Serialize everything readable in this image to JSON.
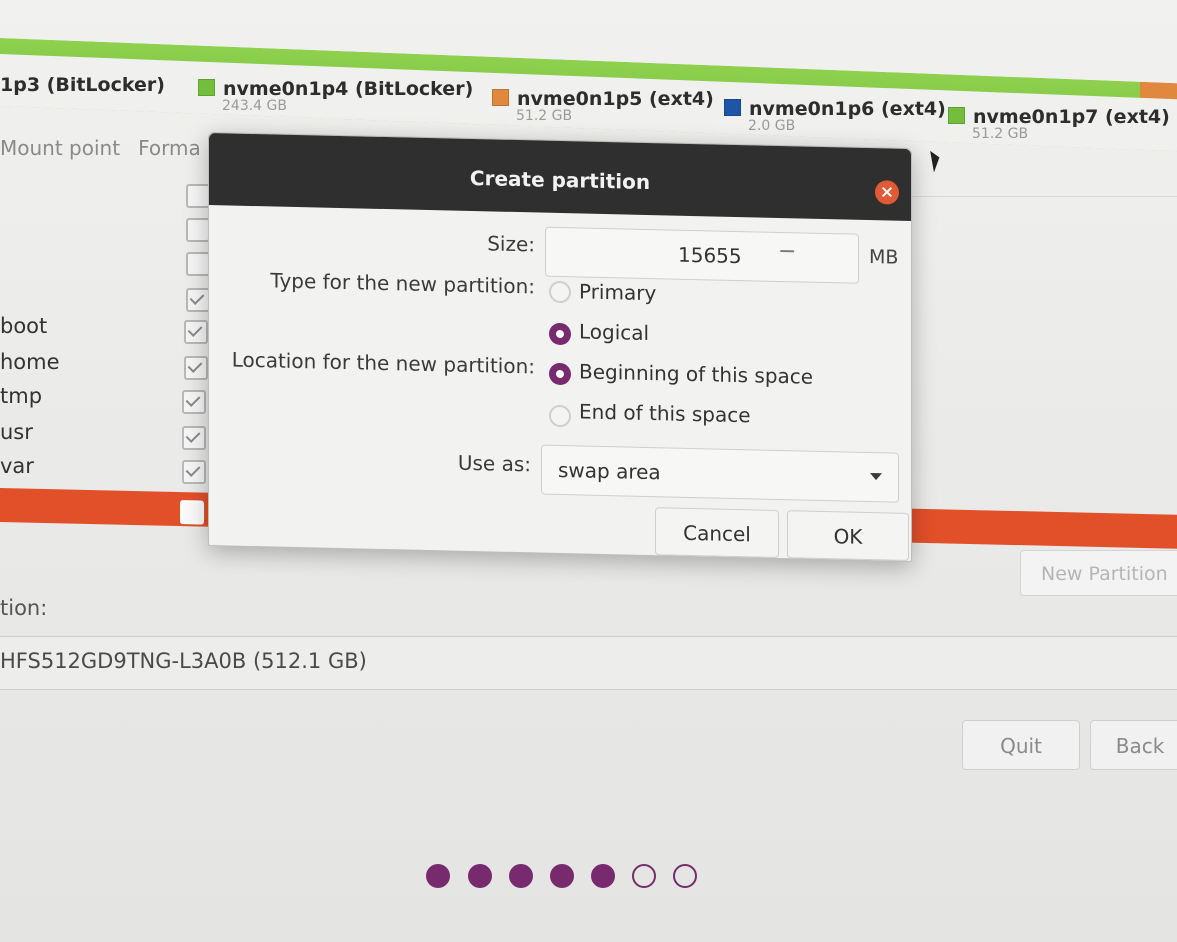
{
  "partitions": [
    {
      "name": "1p3 (BitLocker)",
      "size": "",
      "color": "#8fd14f"
    },
    {
      "name": "nvme0n1p4 (BitLocker)",
      "size": "243.4 GB",
      "color": "#73be3c"
    },
    {
      "name": "nvme0n1p5 (ext4)",
      "size": "51.2 GB",
      "color": "#e0883d"
    },
    {
      "name": "nvme0n1p6 (ext4)",
      "size": "2.0 GB",
      "color": "#1f55a8"
    },
    {
      "name": "nvme0n1p7 (ext4)",
      "size": "51.2 GB",
      "color": "#73be3c"
    }
  ],
  "columns": {
    "mount_point": "Mount point",
    "format": "Forma"
  },
  "mount_rows": [
    {
      "mount": "",
      "checked": false
    },
    {
      "mount": "",
      "checked": false
    },
    {
      "mount": "",
      "checked": false
    },
    {
      "mount": "",
      "checked": true
    },
    {
      "mount": "boot",
      "checked": true
    },
    {
      "mount": "home",
      "checked": true
    },
    {
      "mount": "tmp",
      "checked": true
    },
    {
      "mount": "usr",
      "checked": true
    },
    {
      "mount": "var",
      "checked": true
    },
    {
      "mount": "",
      "checked": false
    }
  ],
  "new_partition_button": "New Partition",
  "boot_loader_label": "tion:",
  "boot_device": "HFS512GD9TNG-L3A0B (512.1 GB)",
  "nav": {
    "quit": "Quit",
    "back": "Back"
  },
  "progress_dots": {
    "total": 7,
    "filled": 5
  },
  "dialog": {
    "title": "Create partition",
    "size_label": "Size:",
    "size_value": "15655",
    "size_decrement": "−",
    "size_unit": "MB",
    "type_label": "Type for the new partition:",
    "type_options": [
      {
        "label": "Primary",
        "selected": false
      },
      {
        "label": "Logical",
        "selected": true
      }
    ],
    "location_label": "Location for the new partition:",
    "location_options": [
      {
        "label": "Beginning of this space",
        "selected": true
      },
      {
        "label": "End of this space",
        "selected": false
      }
    ],
    "use_as_label": "Use as:",
    "use_as_value": "swap area",
    "cancel": "Cancel",
    "ok": "OK"
  },
  "colors": {
    "accent": "#772a6d",
    "selection": "#e2502a",
    "close_button": "#e05a36"
  }
}
